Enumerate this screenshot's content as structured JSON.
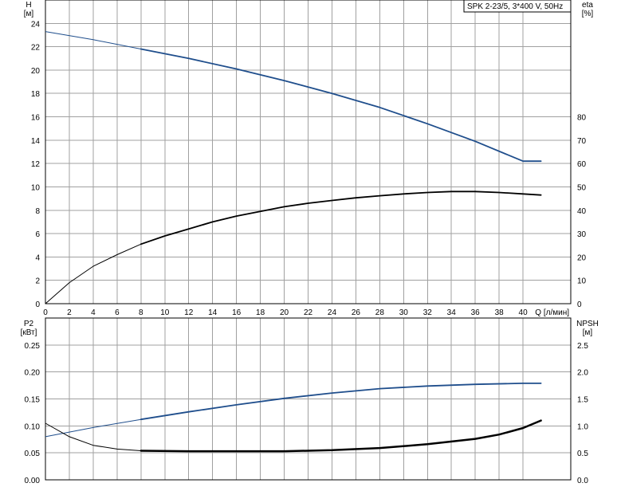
{
  "chart_data": [
    {
      "type": "line",
      "title": "SPK 2-23/5, 3*400 V, 50Hz",
      "xlabel": "Q [л/мин]",
      "x_ticks": [
        "0",
        "2",
        "4",
        "6",
        "8",
        "10",
        "12",
        "14",
        "16",
        "18",
        "20",
        "22",
        "24",
        "26",
        "28",
        "30",
        "32",
        "34",
        "36",
        "38",
        "40"
      ],
      "xlim": [
        0,
        44
      ],
      "y_left": {
        "label_top": "H",
        "label_unit": "[м]",
        "ylim": [
          0,
          26
        ],
        "ticks": [
          "0",
          "2",
          "4",
          "6",
          "8",
          "10",
          "12",
          "14",
          "16",
          "18",
          "20",
          "22",
          "24"
        ]
      },
      "y_right": {
        "label_top": "eta",
        "label_unit": "[%]",
        "ylim": [
          0,
          130
        ],
        "ticks": [
          "0",
          "10",
          "20",
          "30",
          "40",
          "50",
          "60",
          "70",
          "80"
        ]
      },
      "grid": true,
      "series": [
        {
          "name": "H",
          "axis": "left",
          "color": "#1f4e8c",
          "x": [
            0,
            4,
            8,
            12,
            16,
            20,
            24,
            28,
            32,
            36,
            40,
            41.5
          ],
          "y": [
            23.3,
            22.6,
            21.8,
            21.0,
            20.1,
            19.1,
            18.0,
            16.8,
            15.4,
            13.9,
            12.2,
            12.2
          ]
        },
        {
          "name": "eta",
          "axis": "right",
          "color": "#000000",
          "x": [
            0,
            2,
            4,
            6,
            8,
            10,
            12,
            14,
            16,
            18,
            20,
            22,
            24,
            26,
            28,
            30,
            32,
            34,
            36,
            38,
            40,
            41.5
          ],
          "y": [
            0,
            9,
            16,
            21,
            25.5,
            29,
            32,
            35,
            37.5,
            39.5,
            41.5,
            43,
            44.2,
            45.3,
            46.2,
            47,
            47.6,
            48,
            48,
            47.6,
            47,
            46.5
          ]
        }
      ]
    },
    {
      "type": "line",
      "xlabel": "",
      "xlim": [
        0,
        44
      ],
      "y_left": {
        "label_top": "P2",
        "label_unit": "[кВт]",
        "ylim": [
          0,
          0.3
        ],
        "ticks": [
          "0.00",
          "0.05",
          "0.10",
          "0.15",
          "0.20",
          "0.25"
        ]
      },
      "y_right": {
        "label_top": "NPSH",
        "label_unit": "[м]",
        "ylim": [
          0,
          3.0
        ],
        "ticks": [
          "0.0",
          "0.5",
          "1.0",
          "1.5",
          "2.0",
          "2.5"
        ]
      },
      "grid": true,
      "series": [
        {
          "name": "P2",
          "axis": "left",
          "color": "#1f4e8c",
          "x": [
            0,
            4,
            8,
            12,
            16,
            20,
            24,
            28,
            32,
            36,
            40,
            41.5
          ],
          "y": [
            0.08,
            0.097,
            0.112,
            0.126,
            0.139,
            0.151,
            0.161,
            0.169,
            0.174,
            0.177,
            0.179,
            0.179
          ]
        },
        {
          "name": "NPSH",
          "axis": "right",
          "color": "#000000",
          "x": [
            0,
            2,
            4,
            6,
            8,
            12,
            16,
            20,
            24,
            28,
            32,
            36,
            38,
            40,
            41.5
          ],
          "y": [
            1.05,
            0.8,
            0.64,
            0.57,
            0.54,
            0.53,
            0.53,
            0.53,
            0.55,
            0.59,
            0.66,
            0.76,
            0.84,
            0.96,
            1.1
          ]
        }
      ]
    }
  ]
}
